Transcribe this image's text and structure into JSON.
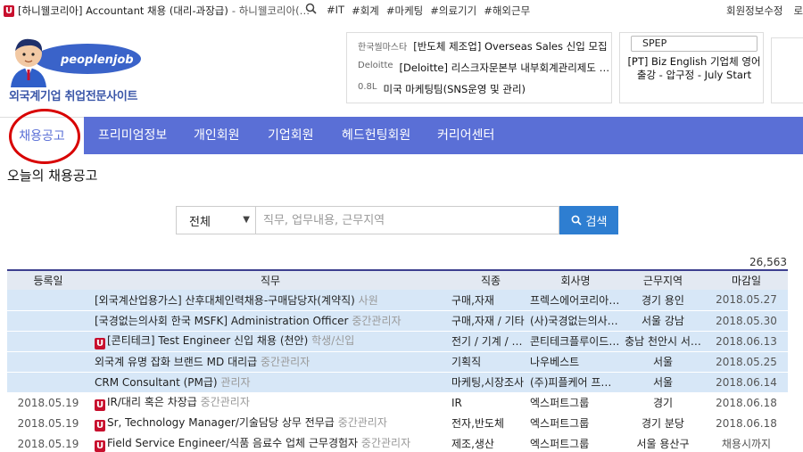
{
  "topbar": {
    "notice_title": "[하니웰코리아] Accountant 채용 (대리-과장급)",
    "notice_sub": "- 하니웰코리아(…",
    "tags": [
      "#IT",
      "#회계",
      "#마케팅",
      "#의료기기",
      "#해외근무"
    ],
    "right_links": [
      "회원정보수정",
      "로그"
    ]
  },
  "header": {
    "logo_text": "peoplenjob",
    "tagline": "외국계기업 취업전문사이트",
    "ads": [
      {
        "company": "한국씰마스타",
        "title": "[반도체 제조업] Overseas Sales 신입 모집"
      },
      {
        "company": "Deloitte",
        "title": "[Deloitte] 리스크자문본부 내부회계관리제도 …"
      },
      {
        "company": "0.8L",
        "title": "미국 마케팅팀(SNS운영 및 관리)"
      }
    ],
    "spep_label": "SPEP",
    "spep_text": "[PT] Biz English 기업체 영어 출강 - 압구정 - July Start"
  },
  "nav": {
    "items": [
      "채용공고",
      "프리미엄정보",
      "개인회원",
      "기업회원",
      "헤드헌팅회원",
      "커리어센터"
    ]
  },
  "page_title": "오늘의 채용공고",
  "search": {
    "category": "전체",
    "placeholder": "직무, 업무내용, 근무지역",
    "button_label": "검색"
  },
  "total_count": "26,563",
  "table": {
    "headers": [
      "등록일",
      "직무",
      "직종",
      "회사명",
      "근무지역",
      "마감일"
    ],
    "rows": [
      {
        "date": "",
        "badge": false,
        "job": "[외국계산업용가스] 산후대체인력채용-구매담당자(계약직)",
        "level": "사원",
        "category": "구매,자재",
        "company": "프렉스에어코리아(…",
        "location": "경기 용인",
        "deadline": "2018.05.27",
        "highlight": true
      },
      {
        "date": "",
        "badge": false,
        "job": "[국경없는의사회 한국 MSFK] Administration Officer",
        "level": "중간관리자",
        "category": "구매,자재 / 기타",
        "company": "(사)국경없는의사…",
        "location": "서울 강남",
        "deadline": "2018.05.30",
        "highlight": true
      },
      {
        "date": "",
        "badge": true,
        "job": "[콘티테크] Test Engineer 신입 채용 (천안)",
        "level": "학생/신입",
        "category": "전기 / 기계 / …",
        "company": "콘티테크플루이드…",
        "location": "충남 천안시 서…",
        "deadline": "2018.06.13",
        "highlight": true
      },
      {
        "date": "",
        "badge": false,
        "job": "외국계 유명 잡화 브랜드 MD 대리급",
        "level": "중간관리자",
        "category": "기획직",
        "company": "나우베스트",
        "location": "서울",
        "deadline": "2018.05.25",
        "highlight": true
      },
      {
        "date": "",
        "badge": false,
        "job": "CRM Consultant (PM급)",
        "level": "관리자",
        "category": "마케팅,시장조사",
        "company": "(주)피플케어 프로…",
        "location": "서울",
        "deadline": "2018.06.14",
        "highlight": true
      },
      {
        "date": "2018.05.19",
        "badge": true,
        "job": "IR/대리 혹은 차장급",
        "level": "중간관리자",
        "category": "IR",
        "company": "엑스퍼트그룹",
        "location": "경기",
        "deadline": "2018.06.18",
        "highlight": false
      },
      {
        "date": "2018.05.19",
        "badge": true,
        "job": "Sr, Technology Manager/기술담당 상무 전무급",
        "level": "중간관리자",
        "category": "전자,반도체",
        "company": "엑스퍼트그룹",
        "location": "경기 분당",
        "deadline": "2018.06.18",
        "highlight": false
      },
      {
        "date": "2018.05.19",
        "badge": true,
        "job": "Field Service Engineer/식품 음료수 업체 근무경험자",
        "level": "중간관리자",
        "category": "제조,생산",
        "company": "엑스퍼트그룹",
        "location": "서울 용산구",
        "deadline": "채용시까지",
        "highlight": false
      }
    ]
  }
}
